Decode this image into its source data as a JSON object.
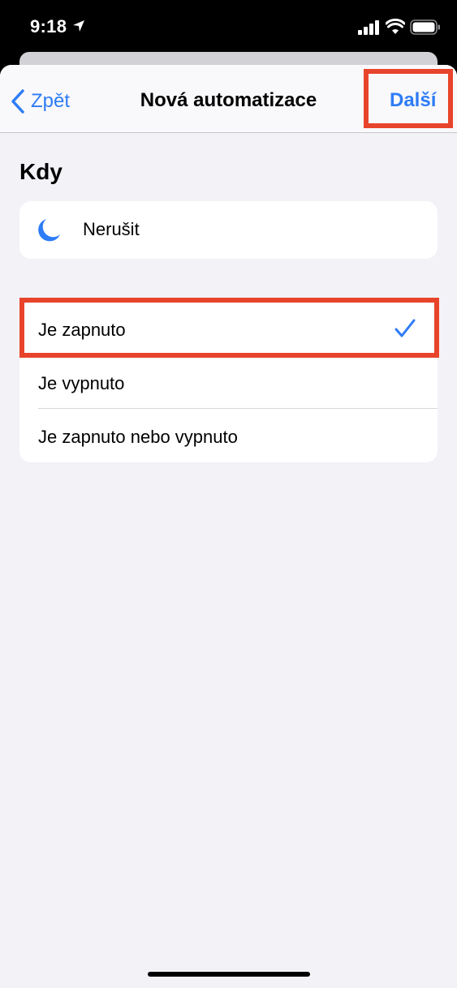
{
  "status_bar": {
    "time": "9:18",
    "icons": [
      "location-arrow-icon",
      "cellular-signal-icon",
      "wifi-icon",
      "battery-icon"
    ]
  },
  "nav": {
    "back_label": "Zpět",
    "title": "Nová automatizace",
    "next_label": "Další"
  },
  "section": {
    "title": "Kdy"
  },
  "trigger": {
    "icon": "moon-icon",
    "label": "Nerušit"
  },
  "options": [
    {
      "label": "Je zapnuto",
      "selected": true
    },
    {
      "label": "Je vypnuto",
      "selected": false
    },
    {
      "label": "Je zapnuto nebo vypnuto",
      "selected": false
    }
  ],
  "colors": {
    "accent": "#2e7cf6",
    "highlight": "#e8442b",
    "background": "#f2f2f7",
    "card": "#ffffff"
  }
}
